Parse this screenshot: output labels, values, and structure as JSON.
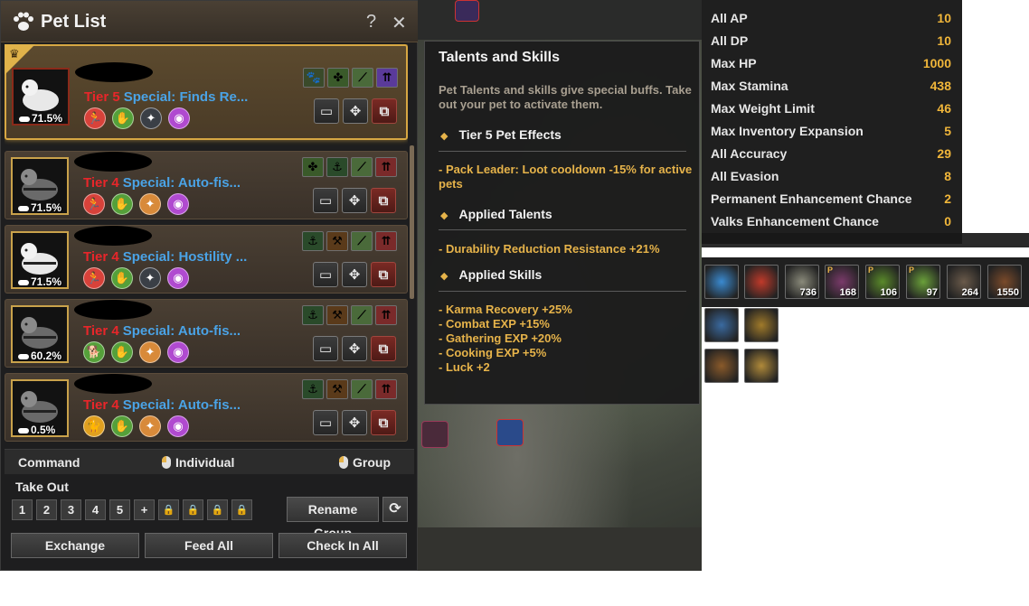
{
  "pet_panel": {
    "title": "Pet List",
    "help_label": "?",
    "close_label": "✕",
    "pets": [
      {
        "tier": "Tier 5",
        "special": "Special: Finds Re...",
        "durability": "71.5%",
        "selected": true,
        "skills": [
          {
            "color": "#d8423a",
            "glyph": "🏃"
          },
          {
            "color": "#55a03a",
            "glyph": "✋"
          },
          {
            "color": "#3a3f46",
            "glyph": "✦"
          },
          {
            "color": "#b04ad0",
            "glyph": "◉"
          }
        ],
        "talents": [
          {
            "color": "#3a4a2a",
            "glyph": "🐾"
          },
          {
            "color": "#3a5a2a",
            "glyph": "✤"
          },
          {
            "color": "#4a6a3a",
            "glyph": "⟋"
          },
          {
            "color": "#5a3a9a",
            "glyph": "⇈"
          }
        ]
      },
      {
        "tier": "Tier 4",
        "special": "Special: Auto-fis...",
        "durability": "71.5%",
        "selected": false,
        "skills": [
          {
            "color": "#d8423a",
            "glyph": "🏃"
          },
          {
            "color": "#55a03a",
            "glyph": "✋"
          },
          {
            "color": "#d88a3a",
            "glyph": "✦"
          },
          {
            "color": "#b04ad0",
            "glyph": "◉"
          }
        ],
        "talents": [
          {
            "color": "#3a5a2a",
            "glyph": "✤"
          },
          {
            "color": "#2a4a2a",
            "glyph": "⚓"
          },
          {
            "color": "#4a6a3a",
            "glyph": "⟋"
          },
          {
            "color": "#7a2a2a",
            "glyph": "⇈"
          }
        ]
      },
      {
        "tier": "Tier 4",
        "special": "Special: Hostility ...",
        "durability": "71.5%",
        "selected": false,
        "skills": [
          {
            "color": "#d8423a",
            "glyph": "🏃"
          },
          {
            "color": "#55a03a",
            "glyph": "✋"
          },
          {
            "color": "#3a3f46",
            "glyph": "✦"
          },
          {
            "color": "#b04ad0",
            "glyph": "◉"
          }
        ],
        "talents": [
          {
            "color": "#2a4a2a",
            "glyph": "⚓"
          },
          {
            "color": "#5a3a1a",
            "glyph": "⚒"
          },
          {
            "color": "#4a6a3a",
            "glyph": "⟋"
          },
          {
            "color": "#7a2a2a",
            "glyph": "⇈"
          }
        ]
      },
      {
        "tier": "Tier 4",
        "special": "Special: Auto-fis...",
        "durability": "60.2%",
        "selected": false,
        "skills": [
          {
            "color": "#55a03a",
            "glyph": "🐕"
          },
          {
            "color": "#55a03a",
            "glyph": "✋"
          },
          {
            "color": "#d88a3a",
            "glyph": "✦"
          },
          {
            "color": "#b04ad0",
            "glyph": "◉"
          }
        ],
        "talents": [
          {
            "color": "#2a4a2a",
            "glyph": "⚓"
          },
          {
            "color": "#5a3a1a",
            "glyph": "⚒"
          },
          {
            "color": "#4a6a3a",
            "glyph": "⟋"
          },
          {
            "color": "#7a2a2a",
            "glyph": "⇈"
          }
        ]
      },
      {
        "tier": "Tier 4",
        "special": "Special: Auto-fis...",
        "durability": "0.5%",
        "selected": false,
        "skills": [
          {
            "color": "#e0a020",
            "glyph": "🐈"
          },
          {
            "color": "#55a03a",
            "glyph": "✋"
          },
          {
            "color": "#d88a3a",
            "glyph": "✦"
          },
          {
            "color": "#b04ad0",
            "glyph": "◉"
          }
        ],
        "talents": [
          {
            "color": "#2a4a2a",
            "glyph": "⚓"
          },
          {
            "color": "#5a3a1a",
            "glyph": "⚒"
          },
          {
            "color": "#4a6a3a",
            "glyph": "⟋"
          },
          {
            "color": "#7a2a2a",
            "glyph": "⇈"
          }
        ]
      }
    ],
    "command_bar": {
      "command": "Command",
      "individual": "Individual",
      "group": "Group"
    },
    "take_out": {
      "label": "Take Out",
      "slots": [
        "1",
        "2",
        "3",
        "4",
        "5",
        "+",
        "🔒",
        "🔒",
        "🔒",
        "🔒"
      ],
      "rename_group": "Rename Group",
      "refresh": "⟳"
    },
    "buttons": {
      "exchange": "Exchange",
      "feed_all": "Feed All",
      "check_in_all": "Check In All"
    }
  },
  "tooltip": {
    "title": "Talents and Skills",
    "description": "Pet Talents and skills give special buffs. Take out your pet to activate them.",
    "section_tier": "Tier 5 Pet Effects",
    "tier_effect": "- Pack Leader: Loot cooldown -15% for active pets",
    "section_talents": "Applied Talents",
    "talent_effect": "- Durability Reduction Resistance +21%",
    "section_skills": "Applied Skills",
    "skill_effects": [
      "- Karma Recovery +25%",
      "- Combat EXP +15%",
      "- Gathering EXP +20%",
      "- Cooking EXP +5%",
      "- Luck +2"
    ]
  },
  "stats": [
    {
      "label": "All AP",
      "value": "10"
    },
    {
      "label": "All DP",
      "value": "10"
    },
    {
      "label": "Max HP",
      "value": "1000"
    },
    {
      "label": "Max Stamina",
      "value": "438"
    },
    {
      "label": "Max Weight Limit",
      "value": "46"
    },
    {
      "label": "Max Inventory Expansion",
      "value": "5"
    },
    {
      "label": "All Accuracy",
      "value": "29"
    },
    {
      "label": "All Evasion",
      "value": "8"
    },
    {
      "label": "Permanent Enhancement Chance",
      "value": "2"
    },
    {
      "label": "Valks Enhancement Chance",
      "value": "0"
    }
  ],
  "inventory": [
    {
      "name": "blue-orb",
      "count": "",
      "color": "#3a8ad0"
    },
    {
      "name": "red-orb",
      "count": "",
      "color": "#c03a2a"
    },
    {
      "name": "scroll",
      "count": "736",
      "color": "#8a8a7a"
    },
    {
      "name": "purple-potion",
      "count": "168",
      "color": "#7a3a6a",
      "p": "P"
    },
    {
      "name": "green-potion",
      "count": "106",
      "color": "#5a8a2a",
      "p": "P"
    },
    {
      "name": "green-elixir",
      "count": "97",
      "color": "#6aa03a",
      "p": "P"
    },
    {
      "name": "bowl",
      "count": "264",
      "color": "#6a5a4a"
    },
    {
      "name": "wood",
      "count": "1550",
      "color": "#7a4a2a"
    },
    {
      "name": "blue-ring",
      "count": "",
      "color": "#3a6aa0"
    },
    {
      "name": "gold-ring",
      "count": "",
      "color": "#a07a2a"
    },
    {
      "name": "compass",
      "count": "",
      "color": "#8a5a2a"
    },
    {
      "name": "treasure",
      "count": "",
      "color": "#b08a3a"
    }
  ]
}
